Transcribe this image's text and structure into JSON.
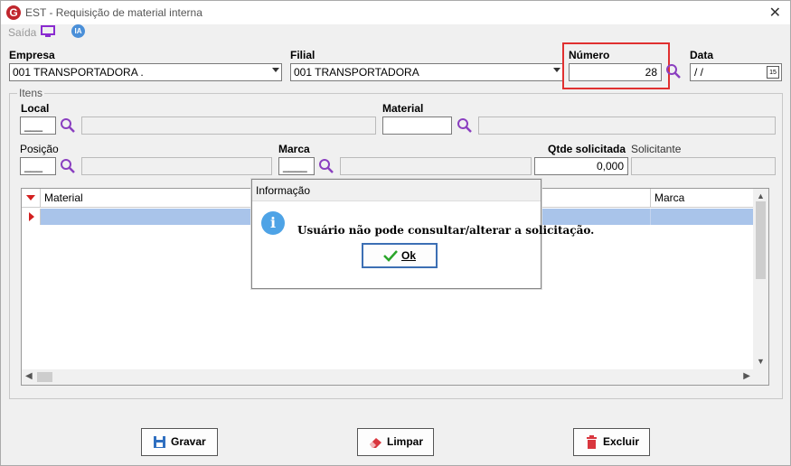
{
  "window": {
    "title": "EST - Requisição de material interna",
    "logo": "G",
    "close": "✕"
  },
  "toolbar": {
    "saida": "Saída",
    "ia": "IA"
  },
  "empresa": {
    "label": "Empresa",
    "value": "001 TRANSPORTADORA ."
  },
  "filial": {
    "label": "Filial",
    "value": "001 TRANSPORTADORA"
  },
  "numero": {
    "label": "Número",
    "value": "28"
  },
  "data": {
    "label": "Data",
    "value": " / /",
    "cal": "15"
  },
  "itens": {
    "group_title": "Itens",
    "local_label": "Local",
    "material_label": "Material",
    "posicao_label": "Posição",
    "marca_label": "Marca",
    "qtde_label": "Qtde solicitada",
    "qtde_value": "0,000",
    "solicitante_label": "Solicitante",
    "local_value": "___",
    "posicao_value": "___",
    "marca_value": "____"
  },
  "grid": {
    "columns": [
      "Material",
      "Marca"
    ]
  },
  "buttons": {
    "gravar": "Gravar",
    "limpar": "Limpar",
    "excluir": "Excluir"
  },
  "dialog": {
    "title": "Informação",
    "message": "Usuário não pode consultar/alterar a solicitação.",
    "ok": "Ok",
    "icon": "i"
  },
  "colors": {
    "highlight": "#e03030",
    "accent": "#a9c4ea",
    "search": "#8a3fc0"
  }
}
